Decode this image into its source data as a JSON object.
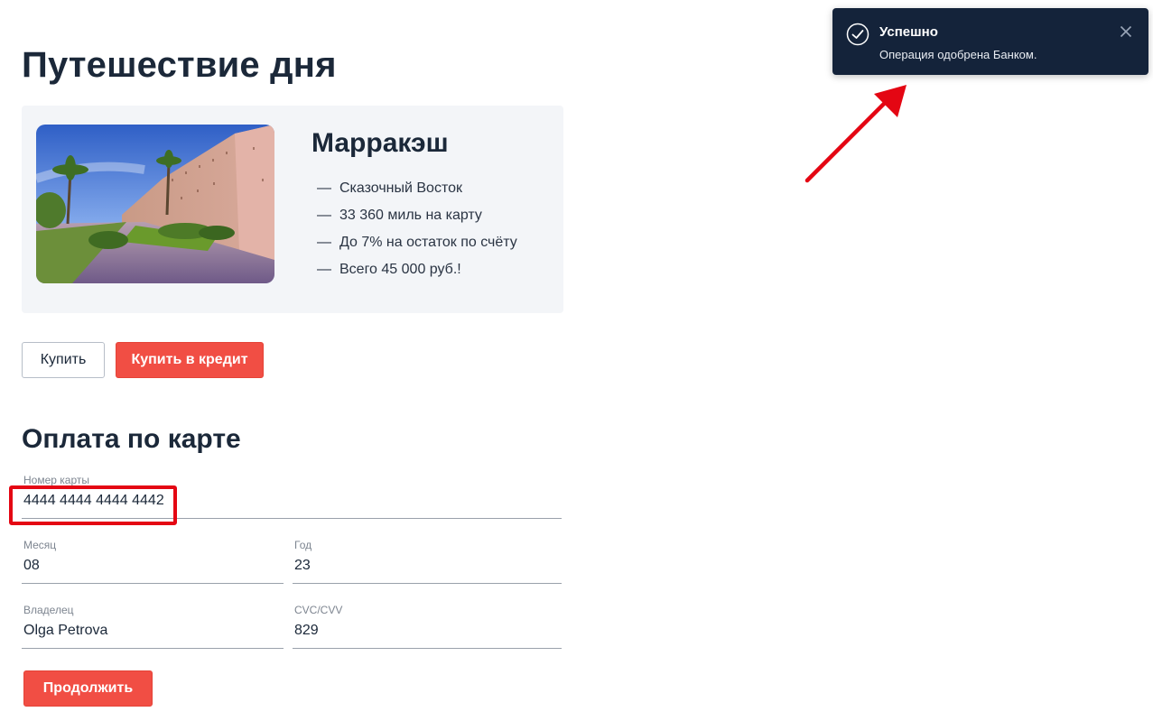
{
  "page": {
    "title": "Путешествие дня"
  },
  "offer": {
    "city": "Марракэш",
    "image_icon": "marrakech-photo",
    "features": [
      {
        "dash": "—",
        "text": "Сказочный Восток"
      },
      {
        "dash": "—",
        "text": "33 360 миль на карту"
      },
      {
        "dash": "—",
        "text": "До 7% на остаток по счёту"
      },
      {
        "dash": "—",
        "text": "Всего 45 000 руб.!"
      }
    ]
  },
  "actions": {
    "buy_label": "Купить",
    "buy_credit_label": "Купить в кредит"
  },
  "payment": {
    "title": "Оплата по карте",
    "card_number": {
      "label": "Номер карты",
      "value": "4444 4444 4444 4442"
    },
    "month": {
      "label": "Месяц",
      "value": "08"
    },
    "year": {
      "label": "Год",
      "value": "23"
    },
    "owner": {
      "label": "Владелец",
      "value": "Olga Petrova"
    },
    "cvc": {
      "label": "CVC/CVV",
      "value": "829"
    },
    "continue_label": "Продолжить"
  },
  "notification": {
    "title": "Успешно",
    "message": "Операция одобрена Банком.",
    "status_icon": "check-circle-icon",
    "close_icon": "close-icon"
  },
  "annotations": {
    "highlight_color": "#e40613",
    "arrow_color": "#e40613"
  },
  "colors": {
    "accent_red": "#f14e44",
    "text_dark": "#1b2839",
    "card_bg": "#f3f5f8",
    "toast_bg": "#14233a"
  }
}
